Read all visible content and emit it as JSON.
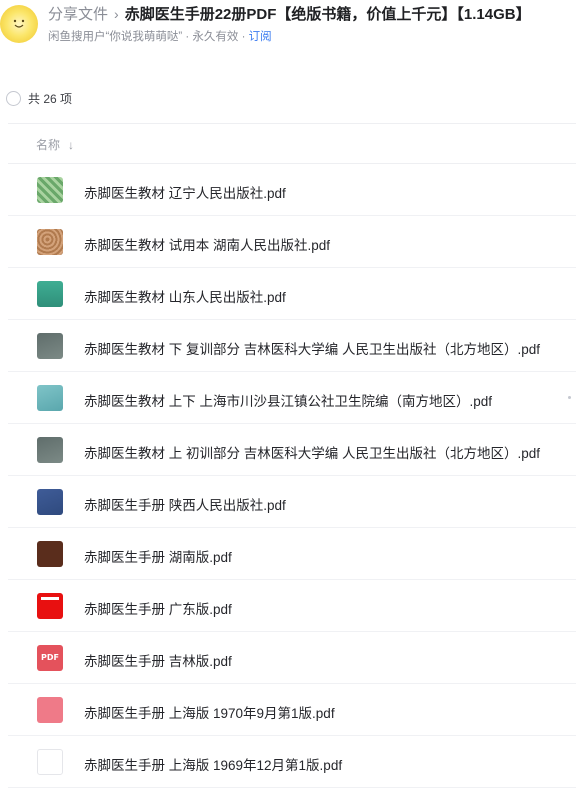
{
  "header": {
    "breadcrumb": "分享文件",
    "separator": "›",
    "title": "赤脚医生手册22册PDF【绝版书籍，价值上千元】【1.14GB】",
    "sharer": "闲鱼搜用户“你说我萌萌哒”",
    "validity": " · 永久有效 · ",
    "subscribe": "订阅"
  },
  "list": {
    "count_label": "共 26 项",
    "column_name": "名称",
    "sort_icon": "↓"
  },
  "files": [
    {
      "name": "赤脚医生教材 辽宁人民出版社.pdf",
      "thumb": "green-pattern"
    },
    {
      "name": "赤脚医生教材 试用本 湖南人民出版社.pdf",
      "thumb": "tan-pattern"
    },
    {
      "name": "赤脚医生教材 山东人民出版社.pdf",
      "thumb": "teal-cover"
    },
    {
      "name": "赤脚医生教材 下 复训部分 吉林医科大学编 人民卫生出版社（北方地区）.pdf",
      "thumb": "gray-cover"
    },
    {
      "name": "赤脚医生教材 上下 上海市川沙县江镇公社卫生院编（南方地区）.pdf",
      "thumb": "cyan-cover"
    },
    {
      "name": "赤脚医生教材 上 初训部分 吉林医科大学编 人民卫生出版社（北方地区）.pdf",
      "thumb": "gray-cover"
    },
    {
      "name": "赤脚医生手册 陕西人民出版社.pdf",
      "thumb": "blue-cover"
    },
    {
      "name": "赤脚医生手册 湖南版.pdf",
      "thumb": "brown-cover"
    },
    {
      "name": "赤脚医生手册 广东版.pdf",
      "thumb": "red-cover"
    },
    {
      "name": "赤脚医生手册 吉林版.pdf",
      "thumb": "pdf-icon"
    },
    {
      "name": "赤脚医生手册 上海版 1970年9月第1版.pdf",
      "thumb": "pink-cover"
    },
    {
      "name": "赤脚医生手册 上海版 1969年12月第1版.pdf",
      "thumb": "white-doc"
    }
  ],
  "pdf_icon_text": "PDF",
  "colors": {
    "link": "#3b7bf0",
    "muted": "#8a8d96"
  }
}
